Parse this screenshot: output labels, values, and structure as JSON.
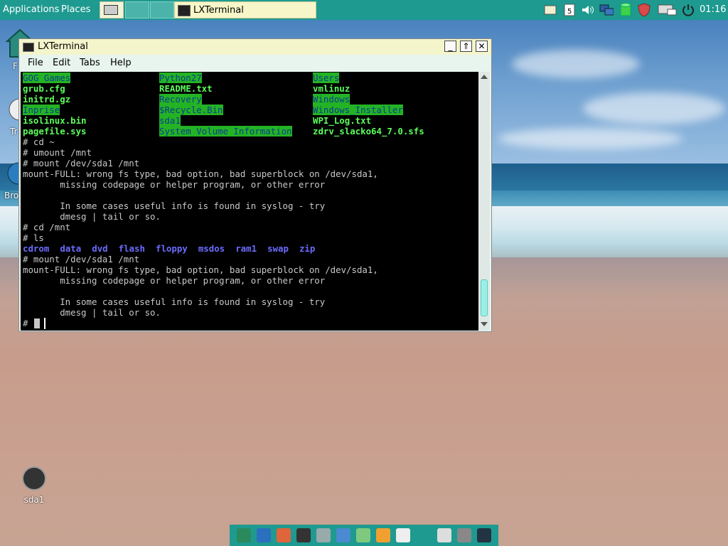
{
  "top_panel": {
    "menus": [
      "Applications",
      "Places"
    ],
    "task_label": "LXTerminal",
    "clock": "01:16",
    "tray_icons": [
      "notes-icon",
      "calendar-icon",
      "volume-icon",
      "network-icon",
      "database-icon",
      "shield-icon",
      "computer-icon",
      "power-icon"
    ],
    "calendar_day": "5"
  },
  "desktop": {
    "icons_partial": [
      "F",
      "Tr",
      "Bro"
    ],
    "drive_label": "sda1"
  },
  "window": {
    "title": "LXTerminal",
    "menus": [
      "File",
      "Edit",
      "Tabs",
      "Help"
    ],
    "buttons": [
      "_",
      "⇑",
      "✕"
    ]
  },
  "terminal": {
    "listing_rows": [
      [
        {
          "t": "GOG Games",
          "s": "g-hi"
        },
        {
          "t": "Python27",
          "s": "g-hi"
        },
        {
          "t": "Users",
          "s": "g-hi"
        }
      ],
      [
        {
          "t": "grub.cfg",
          "s": "g-b"
        },
        {
          "t": "README.txt",
          "s": "g-b"
        },
        {
          "t": "vmlinuz",
          "s": "g-b"
        }
      ],
      [
        {
          "t": "initrd.gz",
          "s": "g-b"
        },
        {
          "t": "Recovery",
          "s": "g-hi"
        },
        {
          "t": "Windows",
          "s": "g-hi"
        }
      ],
      [
        {
          "t": "Inprise",
          "s": "g-hi"
        },
        {
          "t": "$Recycle.Bin",
          "s": "g-hi"
        },
        {
          "t": "Windows_Installer",
          "s": "g-hi"
        }
      ],
      [
        {
          "t": "isolinux.bin",
          "s": "g-b"
        },
        {
          "t": "sda1",
          "s": "g-hi"
        },
        {
          "t": "WPI_Log.txt",
          "s": "g-b"
        }
      ],
      [
        {
          "t": "pagefile.sys",
          "s": "g-b"
        },
        {
          "t": "System Volume Information",
          "s": "g-hi"
        },
        {
          "t": "zdrv_slacko64_7.0.sfs",
          "s": "g-b"
        }
      ]
    ],
    "lines": [
      "# cd ~",
      "# umount /mnt",
      "# mount /dev/sda1 /mnt",
      "mount-FULL: wrong fs type, bad option, bad superblock on /dev/sda1,",
      "       missing codepage or helper program, or other error",
      "",
      "       In some cases useful info is found in syslog - try",
      "       dmesg | tail or so.",
      "# cd /mnt",
      "# ls",
      "__LS__",
      "# mount /dev/sda1 /mnt",
      "mount-FULL: wrong fs type, bad option, bad superblock on /dev/sda1,",
      "       missing codepage or helper program, or other error",
      "",
      "       In some cases useful info is found in syslog - try",
      "       dmesg | tail or so.",
      "# "
    ],
    "ls_items": [
      "cdrom",
      "data",
      "dvd",
      "flash",
      "floppy",
      "msdos",
      "ram1",
      "swap",
      "zip"
    ]
  },
  "dock": {
    "icons": [
      "home-icon",
      "browser-icon",
      "folder-icon",
      "terminal-icon",
      "files-icon",
      "document-icon",
      "spreadsheet-icon",
      "paint-icon",
      "editor-icon",
      "usb-icon",
      "screenshot-icon",
      "package-icon"
    ]
  },
  "colors": {
    "panel": "#1e9a90",
    "titlebar": "#f5f5cc",
    "dir_highlight": "#24b324",
    "exec_green": "#5cff5c",
    "dir_blue": "#6c6cff"
  }
}
